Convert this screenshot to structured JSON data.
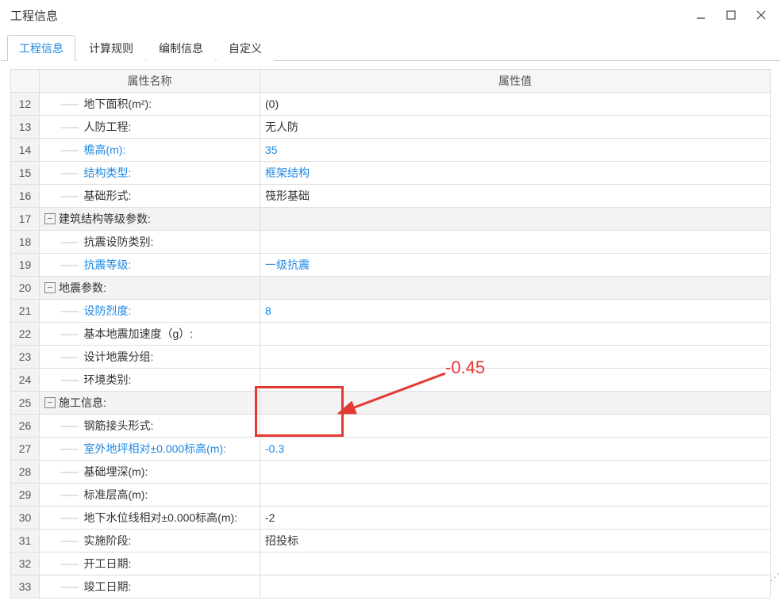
{
  "window": {
    "title": "工程信息"
  },
  "tabs": [
    "工程信息",
    "计算规则",
    "编制信息",
    "自定义"
  ],
  "activeTab": "工程信息",
  "grid": {
    "headers": {
      "name": "属性名称",
      "value": "属性值"
    },
    "rows": [
      {
        "n": "12",
        "name": "地下面积(m²):",
        "val": "(0)",
        "blue": false,
        "indent": 1,
        "gray": false
      },
      {
        "n": "13",
        "name": "人防工程:",
        "val": "无人防",
        "blue": false,
        "indent": 1,
        "gray": false
      },
      {
        "n": "14",
        "name": "檐高(m):",
        "val": "35",
        "blue": true,
        "indent": 1,
        "gray": false
      },
      {
        "n": "15",
        "name": "结构类型:",
        "val": "框架结构",
        "blue": true,
        "indent": 1,
        "gray": false
      },
      {
        "n": "16",
        "name": "基础形式:",
        "val": "筏形基础",
        "blue": false,
        "indent": 1,
        "gray": false
      },
      {
        "n": "17",
        "name": "建筑结构等级参数:",
        "val": "",
        "blue": false,
        "indent": 0,
        "expand": true,
        "gray": true
      },
      {
        "n": "18",
        "name": "抗震设防类别:",
        "val": "",
        "blue": false,
        "indent": 1,
        "gray": false
      },
      {
        "n": "19",
        "name": "抗震等级:",
        "val": "一级抗震",
        "blue": true,
        "indent": 1,
        "gray": false
      },
      {
        "n": "20",
        "name": "地震参数:",
        "val": "",
        "blue": false,
        "indent": 0,
        "expand": true,
        "gray": true
      },
      {
        "n": "21",
        "name": "设防烈度:",
        "val": "8",
        "blue": true,
        "indent": 1,
        "gray": false
      },
      {
        "n": "22",
        "name": "基本地震加速度（g）:",
        "val": "",
        "blue": false,
        "indent": 1,
        "gray": false
      },
      {
        "n": "23",
        "name": "设计地震分组:",
        "val": "",
        "blue": false,
        "indent": 1,
        "gray": false
      },
      {
        "n": "24",
        "name": "环境类别:",
        "val": "",
        "blue": false,
        "indent": 1,
        "gray": false
      },
      {
        "n": "25",
        "name": "施工信息:",
        "val": "",
        "blue": false,
        "indent": 0,
        "expand": true,
        "gray": true
      },
      {
        "n": "26",
        "name": "钢筋接头形式:",
        "val": "",
        "blue": false,
        "indent": 1,
        "gray": false
      },
      {
        "n": "27",
        "name": "室外地坪相对±0.000标高(m):",
        "val": "-0.3",
        "blue": true,
        "indent": 1,
        "gray": false
      },
      {
        "n": "28",
        "name": "基础埋深(m):",
        "val": "",
        "blue": false,
        "indent": 1,
        "gray": false
      },
      {
        "n": "29",
        "name": "标准层高(m):",
        "val": "",
        "blue": false,
        "indent": 1,
        "gray": false
      },
      {
        "n": "30",
        "name": "地下水位线相对±0.000标高(m):",
        "val": "-2",
        "blue": false,
        "indent": 1,
        "gray": false
      },
      {
        "n": "31",
        "name": "实施阶段:",
        "val": "招投标",
        "blue": false,
        "indent": 1,
        "gray": false
      },
      {
        "n": "32",
        "name": "开工日期:",
        "val": "",
        "blue": false,
        "indent": 1,
        "gray": false
      },
      {
        "n": "33",
        "name": "竣工日期:",
        "val": "",
        "blue": false,
        "indent": 1,
        "gray": false
      }
    ]
  },
  "annotation": {
    "text": "-0.45"
  }
}
